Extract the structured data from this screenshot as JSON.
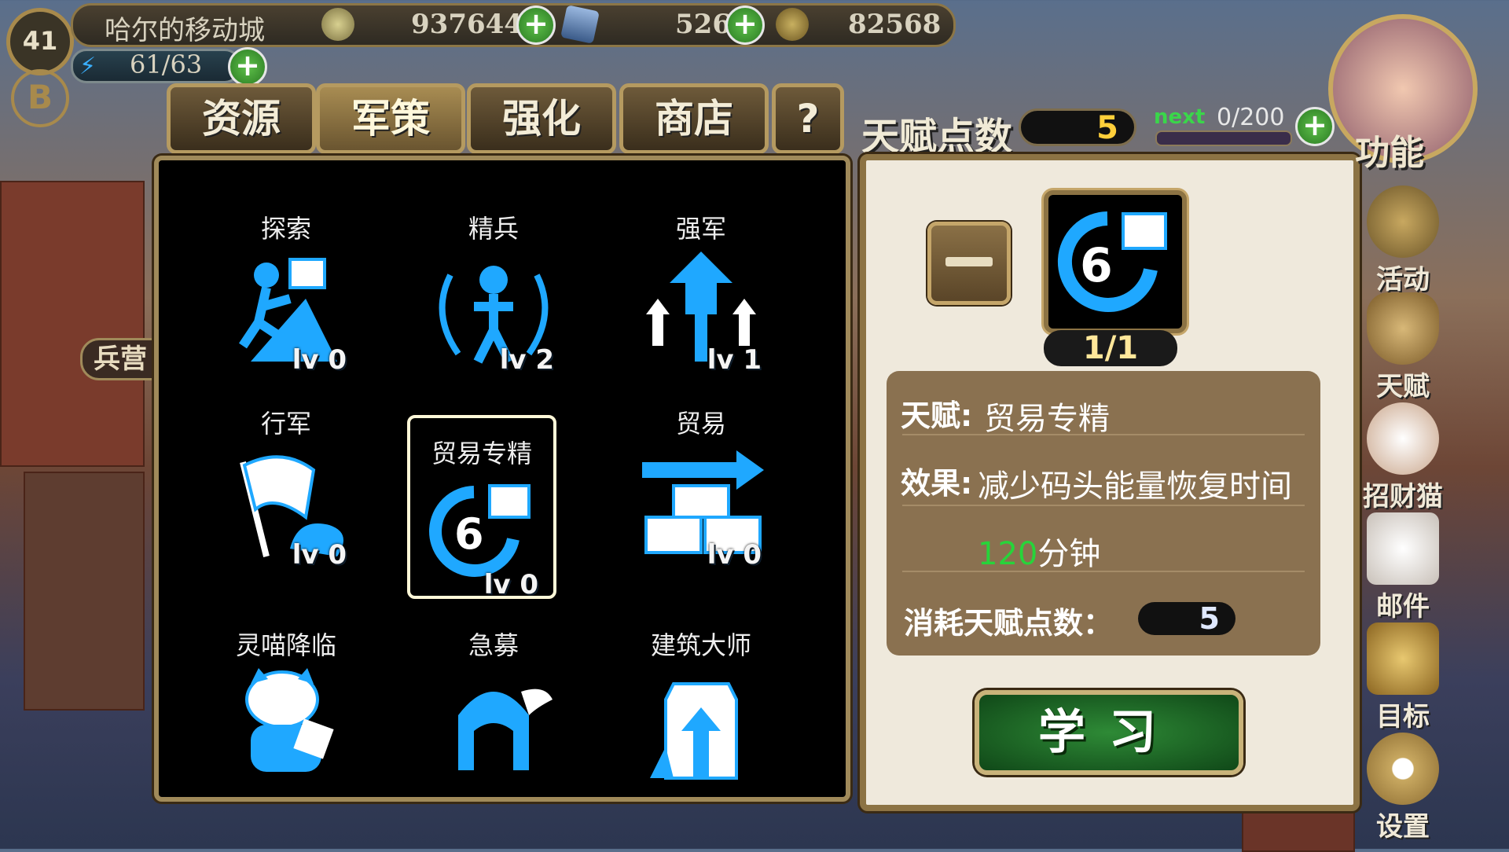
{
  "player": {
    "level": "41",
    "name": "哈尔的移动城",
    "energy": "61/63"
  },
  "currencies": {
    "gold": "937644",
    "gem": "526",
    "third": "82568"
  },
  "tabs": [
    "资源",
    "军策",
    "强化",
    "商店",
    "?"
  ],
  "active_tab": "军策",
  "barracks_label": "兵营",
  "talent": {
    "label": "天赋点数",
    "points": "5",
    "next_label": "next",
    "xp": "0/200"
  },
  "skills": [
    {
      "name": "探索",
      "level": "lv 0"
    },
    {
      "name": "精兵",
      "level": "lv 2"
    },
    {
      "name": "强军",
      "level": "lv 1"
    },
    {
      "name": "行军",
      "level": "lv 0"
    },
    {
      "name": "贸易专精",
      "level": "lv 0"
    },
    {
      "name": "贸易",
      "level": "lv 0"
    },
    {
      "name": "灵喵降临",
      "level": ""
    },
    {
      "name": "急募",
      "level": ""
    },
    {
      "name": "建筑大师",
      "level": ""
    }
  ],
  "detail": {
    "icon_number": "6",
    "count": "1/1",
    "talent_key": "天赋:",
    "talent_name": "贸易专精",
    "effect_key": "效果:",
    "effect_text": "减少码头能量恢复时间",
    "effect_value": "120",
    "effect_unit": "分钟",
    "cost_key": "消耗天赋点数：",
    "cost_value": "5",
    "learn_label": "学习"
  },
  "sidebar": {
    "function_label": "功能",
    "items": [
      "活动",
      "天赋",
      "招财猫",
      "邮件",
      "目标",
      "设置"
    ]
  },
  "colors": {
    "accent_gold": "#b89a5c",
    "skill_blue": "#1fa8ff",
    "effect_green": "#27d43a",
    "learn_green": "#2e8a36"
  }
}
